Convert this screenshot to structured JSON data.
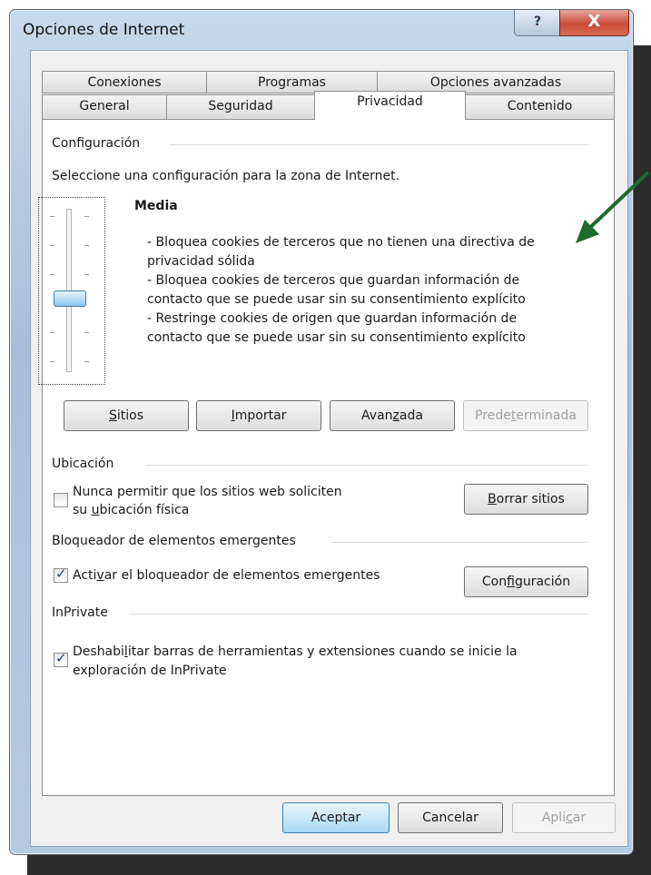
{
  "window": {
    "title": "Opciones de Internet",
    "help_glyph": "?",
    "close_glyph": "X"
  },
  "tabs": {
    "row1": [
      {
        "label": "Conexiones"
      },
      {
        "label": "Programas"
      },
      {
        "label": "Opciones avanzadas"
      }
    ],
    "row2": [
      {
        "label": "General"
      },
      {
        "label": "Seguridad"
      },
      {
        "label": "Privacidad",
        "active": true
      },
      {
        "label": "Contenido"
      }
    ]
  },
  "configuracion": {
    "header": "Configuración",
    "instruction": "Seleccione una configuración para la zona de Internet.",
    "level": "Media",
    "description": [
      "- Bloquea cookies de terceros que no tienen una directiva de",
      "privacidad sólida",
      "- Bloquea cookies de terceros que guardan información de",
      "contacto que se puede usar sin su consentimiento explícito",
      "- Restringe cookies de origen que guardan información de",
      "contacto que se  puede usar sin su consentimiento explícito"
    ],
    "slider_level_index": 3,
    "slider_levels_total": 6
  },
  "buttons_row": {
    "sitios": {
      "pre": "",
      "ul": "S",
      "post": "itios"
    },
    "importar": {
      "pre": "",
      "ul": "I",
      "post": "mportar"
    },
    "avanzada": {
      "pre": "Avan",
      "ul": "z",
      "post": "ada"
    },
    "predeterminada": {
      "pre": "Prede",
      "ul": "t",
      "post": "erminada"
    }
  },
  "ubicacion": {
    "header": "Ubicación",
    "checkbox_line1": "Nunca permitir que los sitios web soliciten",
    "checkbox_line2_pre": "su ",
    "checkbox_line2_ul": "u",
    "checkbox_line2_post": "bicación física",
    "checked": false,
    "button": {
      "pre": "",
      "ul": "B",
      "post": "orrar sitios"
    }
  },
  "bloqueador": {
    "header": "Bloqueador de elementos emergentes",
    "checkbox_pre": "Acti",
    "checkbox_ul": "v",
    "checkbox_post": "ar el bloqueador de elementos emergentes",
    "checked": true,
    "button": {
      "pre": "Con",
      "ul": "f",
      "post": "iguración"
    }
  },
  "inprivate": {
    "header": "InPrivate",
    "checkbox_line1_pre": "Deshabi",
    "checkbox_line1_ul": "l",
    "checkbox_line1_post": "itar barras de herramientas y extensiones cuando se inicie la",
    "checkbox_line2": "exploración de InPrivate",
    "checked": true
  },
  "footer": {
    "aceptar": "Aceptar",
    "cancelar": "Cancelar",
    "aplicar_pre": "Apli",
    "aplicar_ul": "c",
    "aplicar_post": "ar"
  },
  "colors": {
    "arrow": "#1e6b2d",
    "close": "#c74b38",
    "titlebar": "#b6cbe1"
  }
}
